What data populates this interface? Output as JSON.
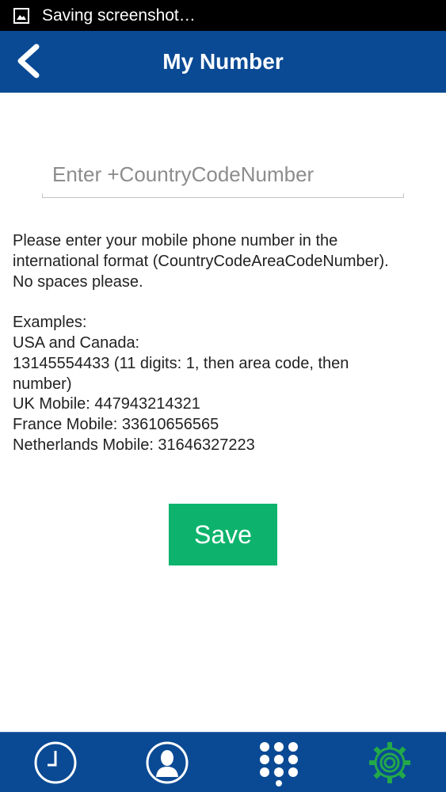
{
  "status_bar": {
    "icon": "image-notification-icon",
    "text": "Saving screenshot…"
  },
  "app_bar": {
    "back_icon": "chevron-left-icon",
    "title": "My Number"
  },
  "phone_input": {
    "value": "",
    "placeholder": "Enter +CountryCodeNumber"
  },
  "instructions": {
    "paragraph": [
      "Please enter your mobile phone number in the",
      "international format (CountryCodeAreaCodeNumber).",
      "No spaces please."
    ],
    "examples": [
      "Examples:",
      "USA and Canada:",
      "13145554433 (11 digits: 1, then area code, then",
      "number)",
      "UK Mobile: 447943214321",
      "France Mobile: 33610656565",
      "Netherlands Mobile: 31646327223"
    ]
  },
  "save_button": {
    "label": "Save"
  },
  "bottom_nav": {
    "items": [
      {
        "icon": "clock-icon",
        "active": false
      },
      {
        "icon": "contact-person-icon",
        "active": false
      },
      {
        "icon": "dialpad-icon",
        "active": false
      },
      {
        "icon": "settings-gear-icon",
        "active": true
      }
    ]
  },
  "colors": {
    "primary": "#0a4a94",
    "accent_green": "#0db36c",
    "active_icon": "#23a84a",
    "status_bar": "#000000"
  }
}
